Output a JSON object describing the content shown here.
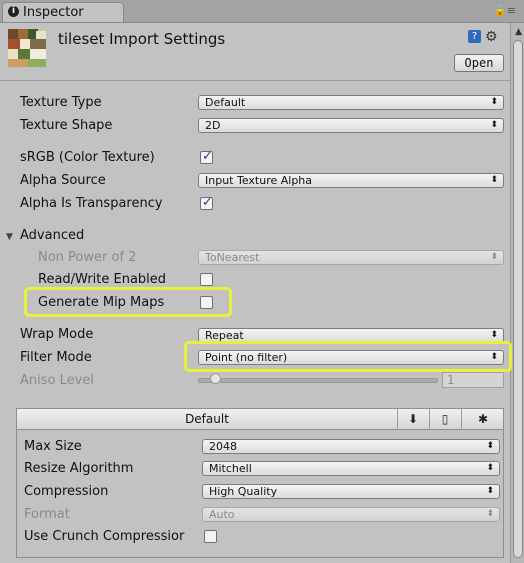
{
  "window": {
    "tab_label": "Inspector",
    "tab_icon": "info-icon"
  },
  "header": {
    "title": "tileset Import Settings",
    "open_label": "Open"
  },
  "fields": {
    "texture_type": {
      "label": "Texture Type",
      "value": "Default"
    },
    "texture_shape": {
      "label": "Texture Shape",
      "value": "2D"
    },
    "srgb": {
      "label": "sRGB (Color Texture)",
      "checked": true
    },
    "alpha_source": {
      "label": "Alpha Source",
      "value": "Input Texture Alpha"
    },
    "alpha_is_transparency": {
      "label": "Alpha Is Transparency",
      "checked": true
    },
    "advanced": {
      "label": "Advanced",
      "expanded": true
    },
    "non_power_of_2": {
      "label": "Non Power of 2",
      "value": "ToNearest",
      "disabled": true
    },
    "read_write": {
      "label": "Read/Write Enabled",
      "checked": false
    },
    "generate_mip_maps": {
      "label": "Generate Mip Maps",
      "checked": false,
      "highlighted": true
    },
    "wrap_mode": {
      "label": "Wrap Mode",
      "value": "Repeat"
    },
    "filter_mode": {
      "label": "Filter Mode",
      "value": "Point (no filter)",
      "highlighted": true
    },
    "aniso_level": {
      "label": "Aniso Level",
      "value": "1",
      "disabled": true
    }
  },
  "platform": {
    "tab_default": "Default",
    "tab_icons": [
      "download-icon",
      "phone-icon",
      "android-icon"
    ],
    "max_size": {
      "label": "Max Size",
      "value": "2048"
    },
    "resize_algorithm": {
      "label": "Resize Algorithm",
      "value": "Mitchell"
    },
    "compression": {
      "label": "Compression",
      "value": "High Quality"
    },
    "format": {
      "label": "Format",
      "value": "Auto",
      "disabled": true
    },
    "use_crunch": {
      "label": "Use Crunch Compression",
      "display_label": "Use Crunch Compressior",
      "checked": false
    }
  },
  "colors": {
    "panel_bg": "#c2c2c2",
    "highlight": "#e7f03a",
    "check": "#1f3f8a"
  }
}
